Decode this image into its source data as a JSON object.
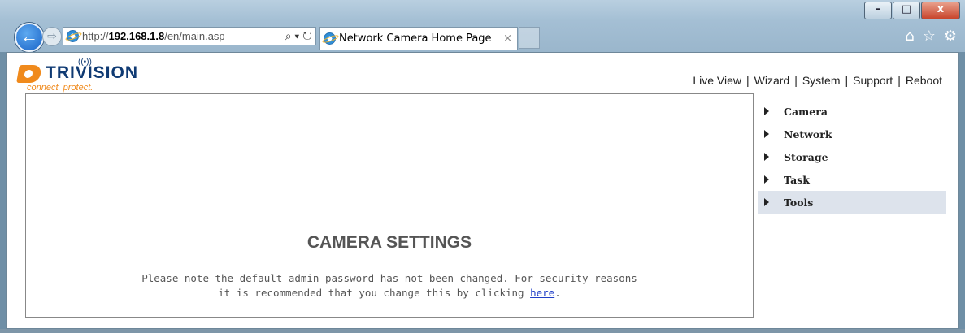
{
  "browser": {
    "url_protocol": "http://",
    "url_host": "192.168.1.8",
    "url_path": "/en/main.asp",
    "address_tools": "⌕ ▾ ↻",
    "tab_title": "Network Camera Home Page",
    "tab_close": "×",
    "window_buttons": {
      "minimize": "–",
      "maximize": "□",
      "close": "x"
    },
    "nav_back": "←",
    "nav_forward": "⇨",
    "toolbar_icons": [
      "⌂",
      "☆",
      "⚙"
    ]
  },
  "logo": {
    "wordmark": "TRIVISION",
    "tagline": "connect. protect."
  },
  "topnav": {
    "items": [
      "Live View",
      "Wizard",
      "System",
      "Support",
      "Reboot"
    ],
    "separator": "|"
  },
  "panel": {
    "title": "CAMERA SETTINGS",
    "note_line1": "Please note the default admin password has not been changed. For security reasons",
    "note_line2_prefix": "it is recommended that you change this by clicking ",
    "note_link": "here",
    "note_line2_suffix": "."
  },
  "sidebar": {
    "items": [
      {
        "label": "Camera",
        "active": false
      },
      {
        "label": "Network",
        "active": false
      },
      {
        "label": "Storage",
        "active": false
      },
      {
        "label": "Task",
        "active": false
      },
      {
        "label": "Tools",
        "active": true
      }
    ]
  },
  "colors": {
    "brand_navy": "#0f3a73",
    "brand_orange": "#f08a1c",
    "active_menu_bg": "#dde3ec",
    "link": "#1f3ec7"
  }
}
